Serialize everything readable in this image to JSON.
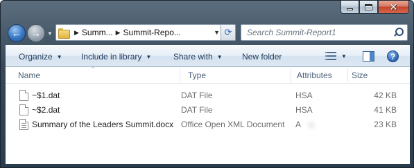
{
  "window": {
    "caption_buttons": [
      "minimize",
      "maximize",
      "close"
    ]
  },
  "address_bar": {
    "crumbs": [
      "Summ...",
      "Summit-Repo..."
    ]
  },
  "search": {
    "placeholder": "Search Summit-Report1"
  },
  "toolbar": {
    "organize": "Organize",
    "include_in_library": "Include in library",
    "share_with": "Share with",
    "new_folder": "New folder"
  },
  "columns": {
    "name": "Name",
    "type": "Type",
    "attributes": "Attributes",
    "size": "Size"
  },
  "files": [
    {
      "name": "~$1.dat",
      "type": "DAT File",
      "attributes": "HSA",
      "size": "42 KB",
      "icon": "blank-file-icon"
    },
    {
      "name": "~$2.dat",
      "type": "DAT File",
      "attributes": "HSA",
      "size": "41 KB",
      "icon": "blank-file-icon"
    },
    {
      "name": "Summary of the Leaders Summit.docx",
      "type": "Office Open XML Document",
      "attributes": "A",
      "size": "23 KB",
      "icon": "document-file-icon"
    }
  ],
  "colors": {
    "title_bar": "#35495a",
    "toolbar_text": "#1e395b",
    "header_text": "#4c607a",
    "close_button": "#c2452c"
  }
}
